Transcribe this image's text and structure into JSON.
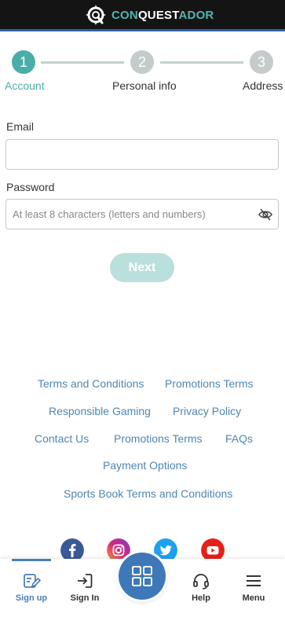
{
  "header": {
    "logo_part1": "CON",
    "logo_part2": "QUEST",
    "logo_part3": "ADOR",
    "colors": {
      "background": "#141414",
      "accent": "#4fb5b0",
      "border": "#2f5fa8"
    }
  },
  "stepper": {
    "steps": [
      {
        "number": "1",
        "label": "Account",
        "state": "active"
      },
      {
        "number": "2",
        "label": "Personal info",
        "state": "inactive"
      },
      {
        "number": "3",
        "label": "Address",
        "state": "inactive"
      }
    ],
    "colors": {
      "active": "#4aaea8",
      "inactive": "#c5cbcb"
    }
  },
  "form": {
    "email_label": "Email",
    "email_value": "",
    "email_placeholder": "",
    "password_label": "Password",
    "password_value": "",
    "password_placeholder": "At least 8 characters (letters and numbers)",
    "password_toggle_icon": "eye-slash-icon",
    "next_label": "Next"
  },
  "footer": {
    "links": [
      "Terms and Conditions",
      "Promotions Terms",
      "Responsible Gaming",
      "Privacy Policy",
      "Contact Us",
      "Promotions Terms",
      "FAQs",
      "Payment Options",
      "Sports Book Terms and Conditions"
    ],
    "social": [
      "facebook-icon",
      "instagram-icon",
      "twitter-icon",
      "youtube-icon"
    ]
  },
  "bottom_nav": {
    "items": [
      {
        "label": "Sign up",
        "icon": "edit-form-icon",
        "active": true
      },
      {
        "label": "Sign In",
        "icon": "sign-in-icon",
        "active": false
      },
      {
        "label": "",
        "icon": "grid-icon",
        "active": false
      },
      {
        "label": "Help",
        "icon": "headset-icon",
        "active": false
      },
      {
        "label": "Menu",
        "icon": "hamburger-menu-icon",
        "active": false
      }
    ],
    "accent": "#4a7fb7"
  }
}
